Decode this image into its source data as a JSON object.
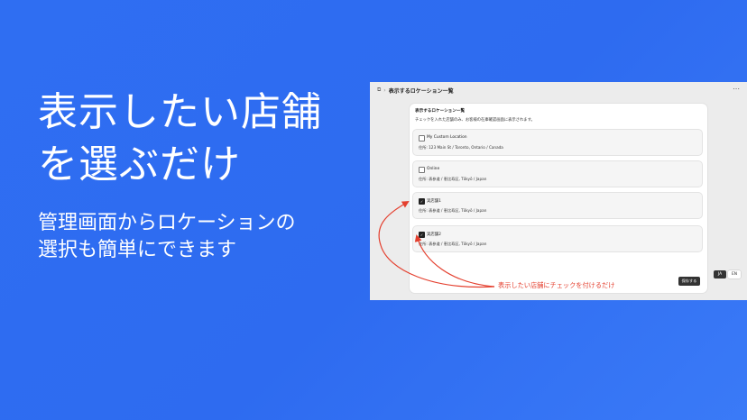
{
  "hero": {
    "title_line1": "表示したい店舗",
    "title_line2": "を選ぶだけ",
    "subtitle_line1": "管理画面からロケーションの",
    "subtitle_line2": "選択も簡単にできます"
  },
  "panel": {
    "breadcrumb_icon": "⧉",
    "breadcrumb_sep": "›",
    "title": "表示するロケーション一覧",
    "more_icon": "⋯",
    "card": {
      "title": "表示するロケーション一覧",
      "description": "チェックを入れた店舗のみ、お客様の在庫確認画面に表示されます。",
      "locations": [
        {
          "name": "My Custom Location",
          "address": "住所: 123 Main St / Toronto, Ontario / Canada",
          "checked": false
        },
        {
          "name": "Online",
          "address": "住所: 表参道 / 恵比寿区, Tōkyō / Japan",
          "checked": false
        },
        {
          "name": "実店舗1",
          "address": "住所: 表参道 / 恵比寿区, Tōkyō / Japan",
          "checked": true
        },
        {
          "name": "実店舗2",
          "address": "住所: 表参道 / 恵比寿区, Tōkyō / Japan",
          "checked": true
        }
      ],
      "save_label": "保存する"
    },
    "languages": {
      "active": "JA",
      "inactive": "EN"
    }
  },
  "annotation": {
    "text": "表示したい店舗にチェックを付けるだけ",
    "color": "#e43f2e"
  },
  "colors": {
    "background": "#2f6ef2",
    "accent_red": "#e43f2e"
  },
  "icons": {
    "checkbox_checked": "checkmark-icon",
    "more": "ellipsis-icon",
    "breadcrumb": "page-icon"
  }
}
